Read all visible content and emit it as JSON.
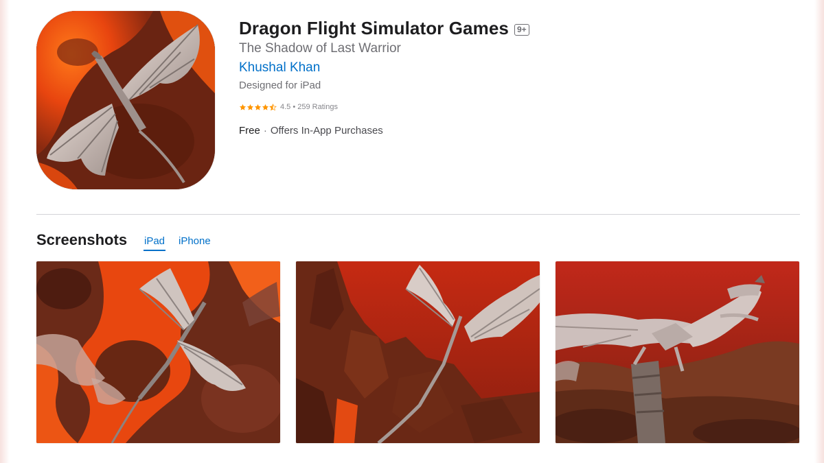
{
  "app": {
    "title": "Dragon Flight Simulator Games",
    "age_rating": "9+",
    "subtitle": "The Shadow of Last Warrior",
    "developer": "Khushal Khan",
    "designed_for": "Designed for iPad",
    "rating": {
      "stars": 4.5,
      "text": "4.5 • 259 Ratings"
    },
    "price": "Free",
    "price_separator": "·",
    "in_app": "Offers In-App Purchases",
    "icon": "dragon-app-icon"
  },
  "screenshots": {
    "title": "Screenshots",
    "tabs": [
      {
        "label": "iPad",
        "selected": true
      },
      {
        "label": "iPhone",
        "selected": false
      }
    ],
    "images": [
      "dragon-over-lava",
      "dragon-over-rock-canyon",
      "dragon-landing-on-tower"
    ]
  },
  "colors": {
    "link": "#0070c9",
    "star": "#ff9500",
    "divider": "#d2d2d7"
  }
}
